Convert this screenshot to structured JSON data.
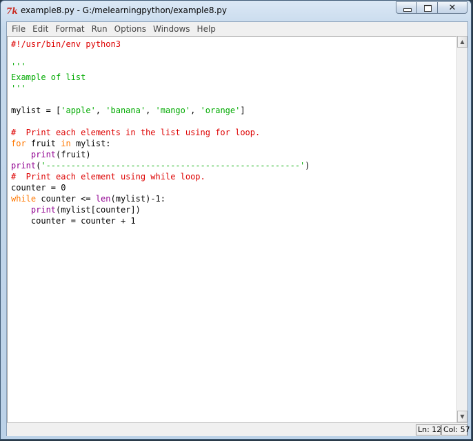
{
  "window": {
    "app_icon_text": "7k",
    "title": "example8.py - G:/melearningpython/example8.py",
    "controls": {
      "minimize": "minimize",
      "maximize": "maximize",
      "close": "close"
    }
  },
  "menu": [
    "File",
    "Edit",
    "Format",
    "Run",
    "Options",
    "Windows",
    "Help"
  ],
  "code_lines": [
    [
      {
        "t": "#!/usr/bin/env python3",
        "c": "cmt"
      }
    ],
    [],
    [
      {
        "t": "'''",
        "c": "str"
      }
    ],
    [
      {
        "t": "Example of list",
        "c": "str"
      }
    ],
    [
      {
        "t": "'''",
        "c": "str"
      }
    ],
    [],
    [
      {
        "t": "mylist = [",
        "c": ""
      },
      {
        "t": "'apple'",
        "c": "str"
      },
      {
        "t": ", ",
        "c": ""
      },
      {
        "t": "'banana'",
        "c": "str"
      },
      {
        "t": ", ",
        "c": ""
      },
      {
        "t": "'mango'",
        "c": "str"
      },
      {
        "t": ", ",
        "c": ""
      },
      {
        "t": "'orange'",
        "c": "str"
      },
      {
        "t": "]",
        "c": ""
      }
    ],
    [],
    [
      {
        "t": "#  Print each elements in the list using for loop.",
        "c": "cmt"
      }
    ],
    [
      {
        "t": "for",
        "c": "kw"
      },
      {
        "t": " fruit ",
        "c": ""
      },
      {
        "t": "in",
        "c": "kw"
      },
      {
        "t": " mylist:",
        "c": ""
      }
    ],
    [
      {
        "t": "    ",
        "c": ""
      },
      {
        "t": "print",
        "c": "bi"
      },
      {
        "t": "(fruit)",
        "c": ""
      }
    ],
    [
      {
        "t": "print",
        "c": "bi"
      },
      {
        "t": "(",
        "c": ""
      },
      {
        "t": "'---------------------------------------------------'",
        "c": "str"
      },
      {
        "t": ")",
        "c": ""
      }
    ],
    [
      {
        "t": "#  Print each element using while loop.",
        "c": "cmt"
      }
    ],
    [
      {
        "t": "counter = 0",
        "c": ""
      }
    ],
    [
      {
        "t": "while",
        "c": "kw"
      },
      {
        "t": " counter <= ",
        "c": ""
      },
      {
        "t": "len",
        "c": "bi"
      },
      {
        "t": "(mylist)-1:",
        "c": ""
      }
    ],
    [
      {
        "t": "    ",
        "c": ""
      },
      {
        "t": "print",
        "c": "bi"
      },
      {
        "t": "(mylist[counter])",
        "c": ""
      }
    ],
    [
      {
        "t": "    counter = counter + 1",
        "c": ""
      }
    ]
  ],
  "status": {
    "line": "Ln: 12",
    "col": "Col: 57"
  }
}
